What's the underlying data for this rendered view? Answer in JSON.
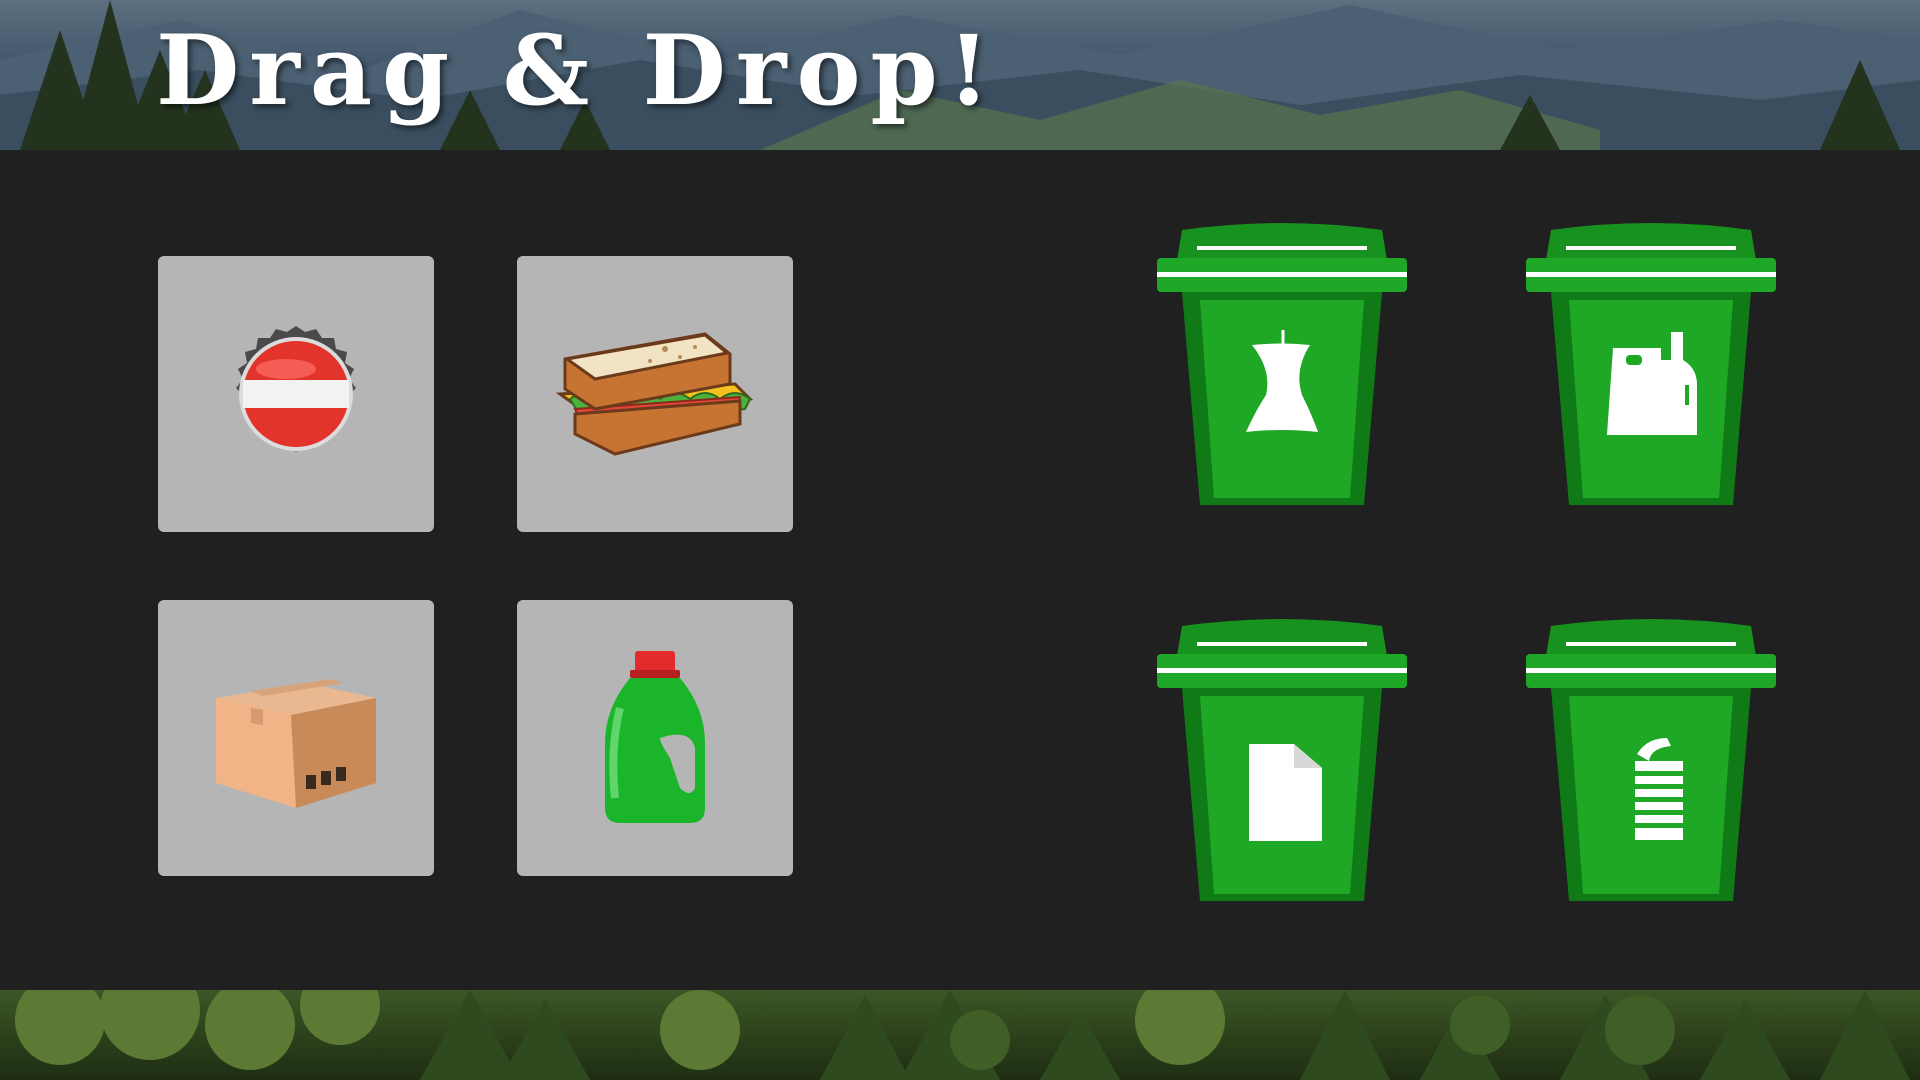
{
  "page": {
    "title": "Drag & Drop!"
  },
  "items": [
    {
      "id": "bottle-cap",
      "icon": "bottle-cap-icon"
    },
    {
      "id": "sandwich",
      "icon": "sandwich-icon"
    },
    {
      "id": "cardboard-box",
      "icon": "cardboard-box-icon"
    },
    {
      "id": "plastic-jug",
      "icon": "plastic-jug-icon"
    }
  ],
  "bins": [
    {
      "id": "organic",
      "icon": "apple-core-icon"
    },
    {
      "id": "plastic",
      "icon": "bag-and-bottle-icon"
    },
    {
      "id": "paper",
      "icon": "paper-sheet-icon"
    },
    {
      "id": "metal",
      "icon": "tin-can-icon"
    }
  ],
  "colors": {
    "panel": "#202020",
    "tile": "#b5b5b5",
    "bin_green": "#1a9e22",
    "title": "#ffffff"
  }
}
